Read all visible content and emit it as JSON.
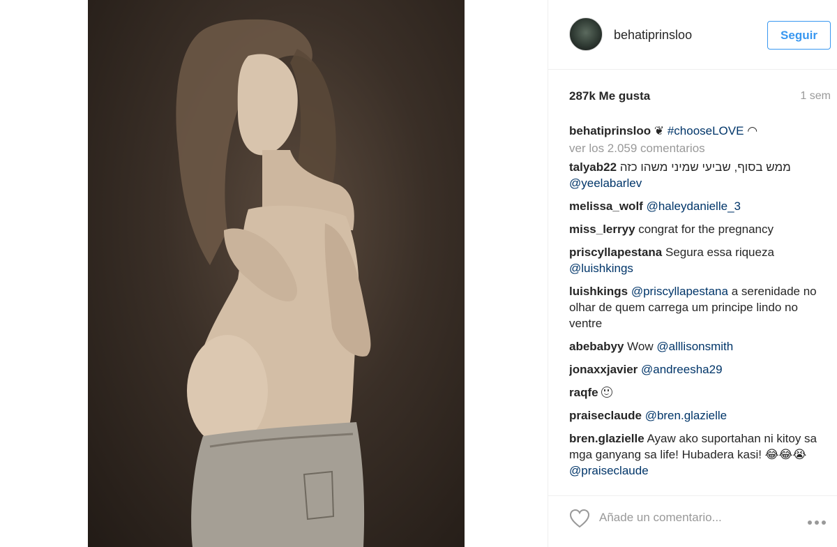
{
  "post": {
    "username": "behatiprinsloo",
    "follow_label": "Seguir",
    "likes": "287k Me gusta",
    "time": "1 sem",
    "caption_user": "behatiprinsloo",
    "caption_text": "#chooseLOVE",
    "view_all": "ver los 2.059 comentarios"
  },
  "comments": [
    {
      "user": "talyab22",
      "text": "ממש בסוף, שביעי שמיני משהו כזה",
      "mention": "@yeelabarlev",
      "tail": ""
    },
    {
      "user": "melissa_wolf",
      "text": "",
      "mention": "@haleydanielle_3",
      "tail": ""
    },
    {
      "user": "miss_lerryy",
      "text": "congrat for the pregnancy",
      "mention": "",
      "tail": ""
    },
    {
      "user": "priscyllapestana",
      "text": "Segura essa riqueza",
      "mention": "@luishkings",
      "tail": ""
    },
    {
      "user": "luishkings",
      "text": "",
      "mention": "@priscyllapestana",
      "tail": "a serenidade no olhar de quem carrega um principe lindo no ventre"
    },
    {
      "user": "abebabyy",
      "text": "Wow",
      "mention": "@alllisonsmith",
      "tail": ""
    },
    {
      "user": "jonaxxjavier",
      "text": "",
      "mention": "@andreesha29",
      "tail": ""
    },
    {
      "user": "raqfe",
      "text": "",
      "mention": "",
      "tail": ""
    },
    {
      "user": "praiseclaude",
      "text": "",
      "mention": "@bren.glazielle",
      "tail": ""
    },
    {
      "user": "bren.glazielle",
      "text": "Ayaw ako suportahan ni kitoy sa mga ganyang sa life! Hubadera kasi! 😂😂😭",
      "mention": "@praiseclaude",
      "tail": ""
    }
  ],
  "footer": {
    "placeholder": "Añade un comentario..."
  },
  "icons": {
    "heart": "heart-icon",
    "more": "more-options-icon",
    "smiley": "smiley-icon"
  }
}
